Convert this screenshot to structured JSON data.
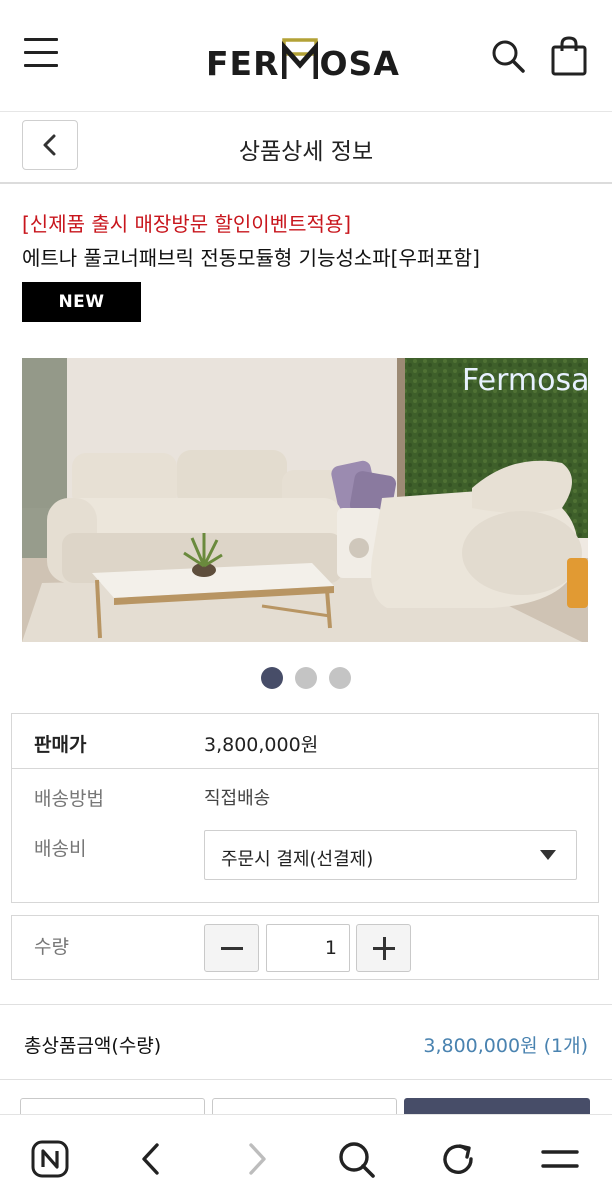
{
  "header": {
    "brand": "FERMOSA",
    "brand_left": "FER",
    "brand_right": "OSA"
  },
  "subheader": {
    "title": "상품상세 정보"
  },
  "product": {
    "promo": "[신제품 출시 매장방문 할인이벤트적용]",
    "name": "에트나 풀코너패브릭 전동모듈형 기능성소파[우퍼포함]",
    "badge": "NEW",
    "image_sign": "Fermosa"
  },
  "carousel": {
    "count": 3,
    "active_index": 0
  },
  "pricing": {
    "price_label": "판매가",
    "price_value": "3,800,000원",
    "shipping_method_label": "배송방법",
    "shipping_method_value": "직접배송",
    "shipping_fee_label": "배송비",
    "shipping_fee_selected": "주문시 결제(선결제)"
  },
  "quantity": {
    "label": "수량",
    "value": "1"
  },
  "total": {
    "label": "총상품금액(수량)",
    "value": "3,800,000원 (1개)"
  },
  "colors": {
    "accent_red": "#c8161d",
    "total_blue": "#4a83b0",
    "dot_active": "#474d68",
    "logo_gold": "#b3a237"
  },
  "browser_bar": {
    "icons": [
      "n-icon",
      "back-icon",
      "forward-icon",
      "search-icon",
      "refresh-icon",
      "menu-icon"
    ]
  }
}
